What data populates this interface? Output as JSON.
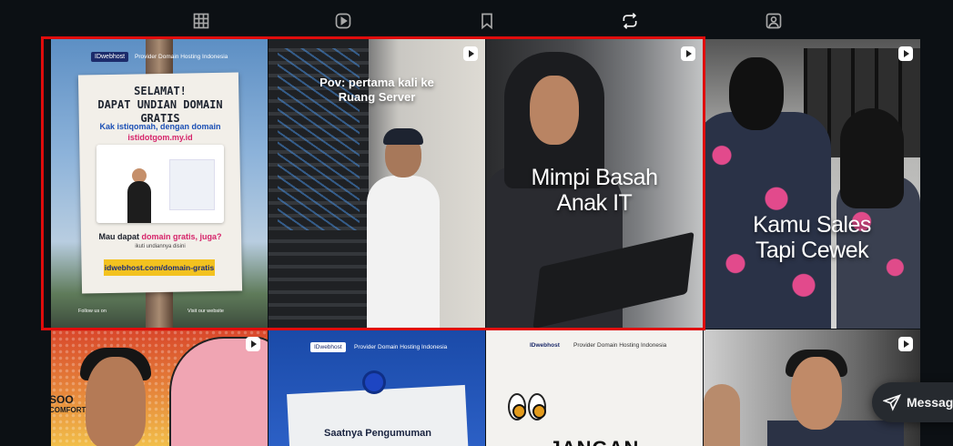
{
  "tabs": [
    {
      "id": "posts",
      "icon": "grid-icon",
      "active": false
    },
    {
      "id": "reels",
      "icon": "reels-icon",
      "active": false
    },
    {
      "id": "saved",
      "icon": "bookmark-icon",
      "active": false
    },
    {
      "id": "reposts",
      "icon": "repost-icon",
      "active": true
    },
    {
      "id": "tagged",
      "icon": "tagged-icon",
      "active": false
    }
  ],
  "posts": [
    {
      "brand": "IDwebhost",
      "brand_sub": "Provider Domain Hosting Indonesia",
      "title_lines": [
        "SELAMAT!",
        "DAPAT UNDIAN DOMAIN GRATIS"
      ],
      "name": "Kak istiqomah, dengan domain",
      "domain": "istidotgom.my.id",
      "question_a": "Mau dapat",
      "question_pink": "domain gratis, juga?",
      "hint": "ikuti undiannya disini",
      "cta": "idwebhost.com/domain-gratis",
      "foot_left": "Follow us on",
      "foot_right": "Visit our website",
      "is_reel": false
    },
    {
      "overlay": "Pov: pertama kali ke\nRuang Server",
      "is_reel": true
    },
    {
      "overlay": "Mimpi Basah\nAnak IT",
      "is_reel": true
    },
    {
      "overlay": "Kamu Sales\nTapi Cewek",
      "is_reel": true
    },
    {
      "comic_text": "SOO",
      "comic_text2": "COMFORT",
      "is_reel": true
    },
    {
      "brand": "IDwebhost",
      "brand_sub": "Provider Domain Hosting Indonesia",
      "title": "Saatnya Pengumuman",
      "is_reel": false
    },
    {
      "brand": "IDwebhost",
      "brand_sub": "Provider Domain Hosting Indonesia",
      "big": "JANGAN",
      "is_reel": false
    },
    {
      "is_reel": true
    }
  ],
  "message_button": {
    "label": "Message",
    "icon": "send-icon"
  }
}
